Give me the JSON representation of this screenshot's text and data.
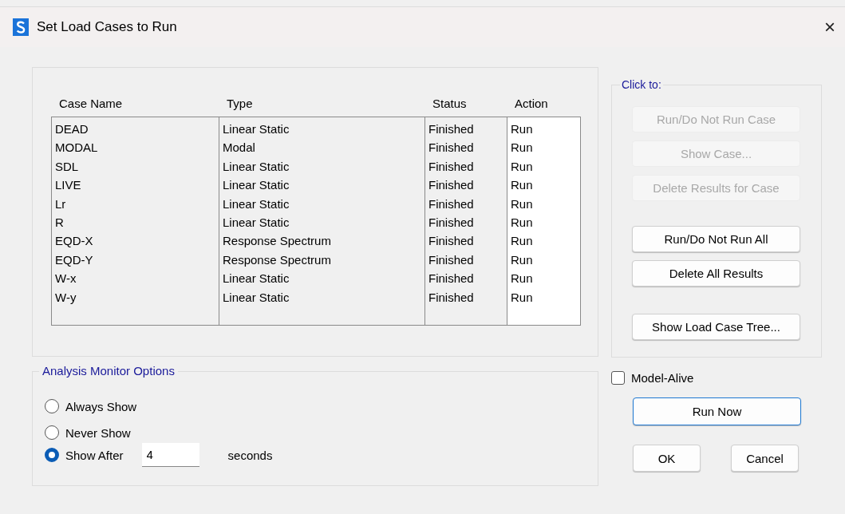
{
  "window": {
    "title": "Set Load Cases to Run",
    "close": "×"
  },
  "cases_table": {
    "columns": [
      "Case Name",
      "Type",
      "Status",
      "Action"
    ],
    "rows": [
      {
        "case_name": "DEAD",
        "type": "Linear Static",
        "status": "Finished",
        "action": "Run"
      },
      {
        "case_name": "MODAL",
        "type": "Modal",
        "status": "Finished",
        "action": "Run"
      },
      {
        "case_name": "SDL",
        "type": "Linear Static",
        "status": "Finished",
        "action": "Run"
      },
      {
        "case_name": "LIVE",
        "type": "Linear Static",
        "status": "Finished",
        "action": "Run"
      },
      {
        "case_name": "Lr",
        "type": "Linear Static",
        "status": "Finished",
        "action": "Run"
      },
      {
        "case_name": "R",
        "type": "Linear Static",
        "status": "Finished",
        "action": "Run"
      },
      {
        "case_name": "EQD-X",
        "type": "Response Spectrum",
        "status": "Finished",
        "action": "Run"
      },
      {
        "case_name": "EQD-Y",
        "type": "Response Spectrum",
        "status": "Finished",
        "action": "Run"
      },
      {
        "case_name": "W-x",
        "type": "Linear Static",
        "status": "Finished",
        "action": "Run"
      },
      {
        "case_name": "W-y",
        "type": "Linear Static",
        "status": "Finished",
        "action": "Run"
      }
    ]
  },
  "click_to": {
    "title": "Click to:",
    "groups": [
      {
        "buttons": [
          {
            "label": "Run/Do Not Run Case",
            "disabled": true
          },
          {
            "label": "Show Case...",
            "disabled": true
          },
          {
            "label": "Delete Results for Case",
            "disabled": true
          }
        ]
      },
      {
        "buttons": [
          {
            "label": "Run/Do Not Run All",
            "disabled": false
          },
          {
            "label": "Delete All Results",
            "disabled": false
          }
        ]
      },
      {
        "buttons": [
          {
            "label": "Show Load Case Tree...",
            "disabled": false
          }
        ]
      }
    ]
  },
  "analysis_monitor": {
    "title": "Analysis Monitor Options",
    "options": [
      {
        "label": "Always Show",
        "selected": false
      },
      {
        "label": "Never Show",
        "selected": false
      },
      {
        "label": "Show After",
        "selected": true
      }
    ],
    "seconds_value": "4",
    "seconds_label": "seconds"
  },
  "model_alive": {
    "label": "Model-Alive",
    "checked": false
  },
  "buttons": [
    {
      "label": "Run Now",
      "kind": "wide"
    },
    {
      "label": "OK",
      "kind": "small"
    },
    {
      "label": "Cancel",
      "kind": "small"
    }
  ]
}
